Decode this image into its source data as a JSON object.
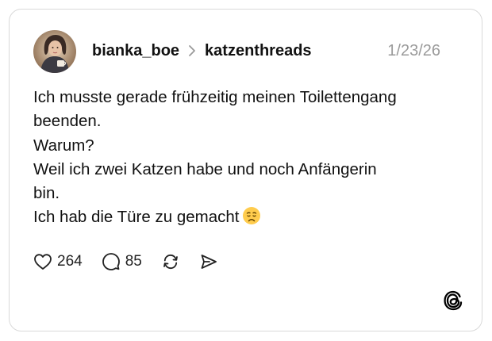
{
  "post": {
    "username": "bianka_boe",
    "community": "katzenthreads",
    "date": "1/23/26",
    "lines": [
      "Ich musste gerade frühzeitig meinen Toilettengang",
      "beenden.",
      "Warum?",
      "Weil ich zwei Katzen habe und noch Anfängerin",
      "bin.",
      "Ich hab die Türe zu gemacht"
    ],
    "emoji": "tired-face-emoji"
  },
  "actions": {
    "likes": "264",
    "replies": "85",
    "icons": [
      "heart-icon",
      "comment-icon",
      "repost-icon",
      "share-icon"
    ]
  },
  "branding": {
    "logo": "threads-logo-icon"
  }
}
